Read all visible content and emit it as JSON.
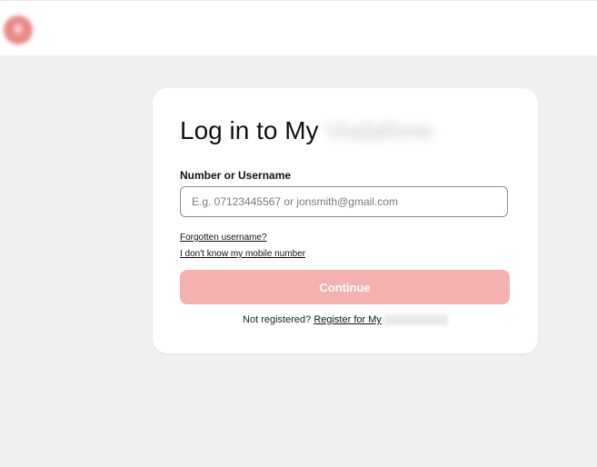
{
  "header": {
    "logo_icon": "vodafone-logo-icon"
  },
  "login": {
    "title": "Log in to My",
    "title_brand_blurred": "Vodafone",
    "field_label": "Number or Username",
    "input_value": "",
    "input_placeholder": "E.g. 07123445567 or jonsmith@gmail.com",
    "forgot_link": "Forgotten username?",
    "no_mobile_link": "I don't know my mobile number",
    "continue_label": "Continue",
    "not_registered_text": "Not registered?",
    "register_link": "Register for My"
  },
  "colors": {
    "accent": "#e60000",
    "button_disabled": "#f5b1b0",
    "background": "#f1f0ef"
  }
}
